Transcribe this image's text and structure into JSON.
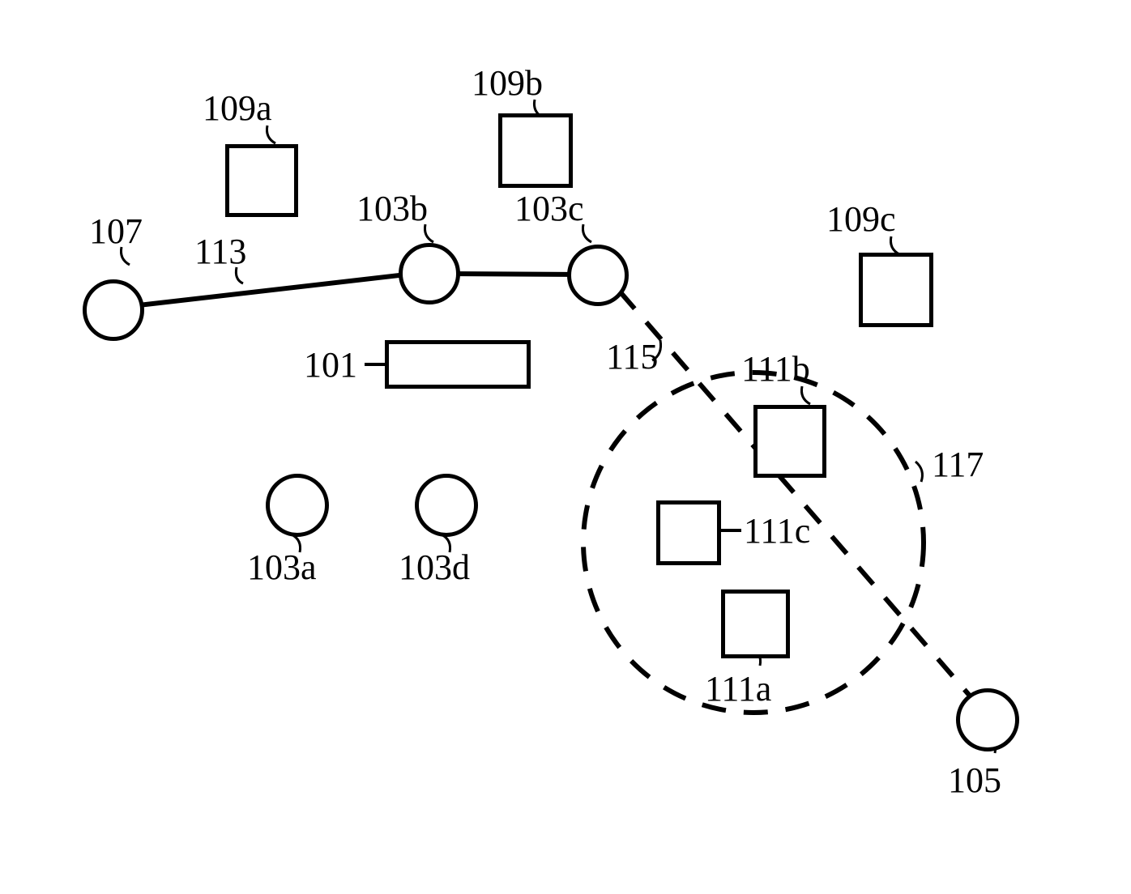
{
  "labels": {
    "node_107": "107",
    "node_103a": "103a",
    "node_103b": "103b",
    "node_103c": "103c",
    "node_103d": "103d",
    "node_105": "105",
    "box_101": "101",
    "box_109a": "109a",
    "box_109b": "109b",
    "box_109c": "109c",
    "box_111a": "111a",
    "box_111b": "111b",
    "box_111c": "111c",
    "edge_113": "113",
    "edge_115": "115",
    "region_117": "117"
  }
}
